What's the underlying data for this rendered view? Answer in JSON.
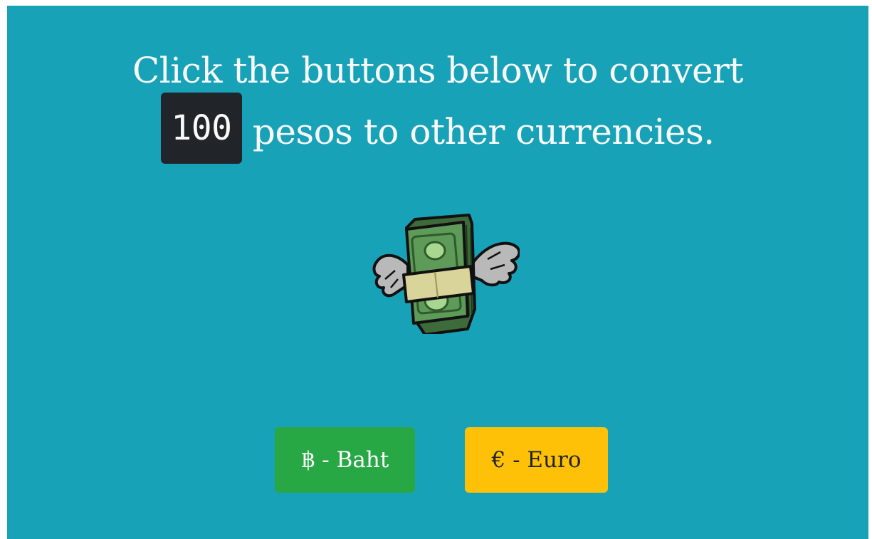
{
  "heading": {
    "line1": "Click the buttons below to convert",
    "amount": "100",
    "line2_rest": " pesos to other currencies."
  },
  "illustration": {
    "icon": "flying-money-icon"
  },
  "buttons": {
    "baht_label": "฿ - Baht",
    "euro_label": "€ - Euro"
  },
  "colors": {
    "panel": "#17a2b8",
    "baht_button": "#28a745",
    "euro_button": "#ffc107",
    "badge": "#212529"
  }
}
